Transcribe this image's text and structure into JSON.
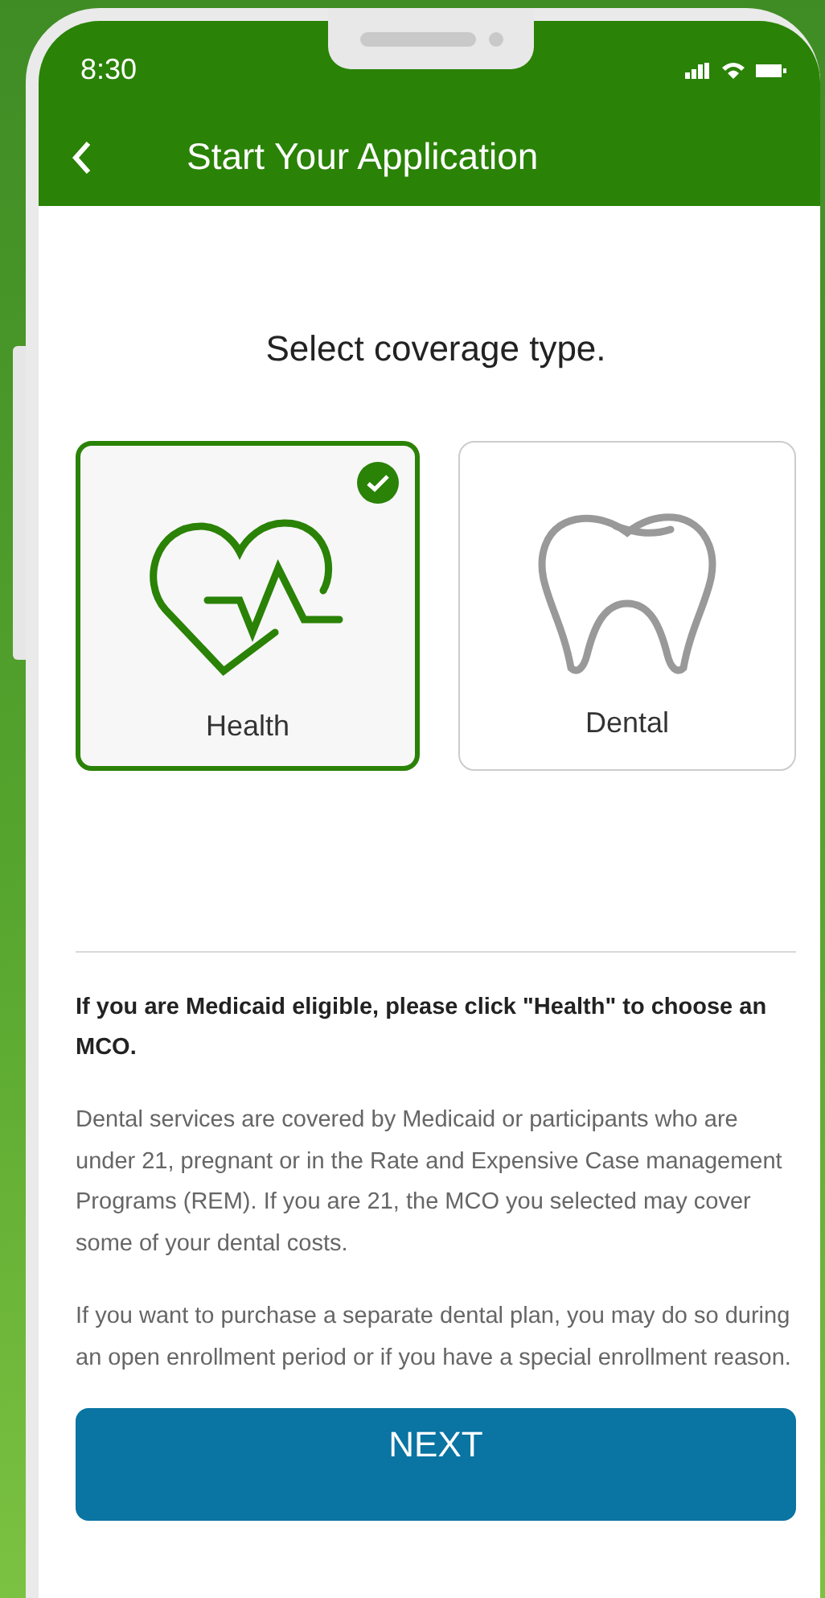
{
  "status_bar": {
    "time": "8:30"
  },
  "header": {
    "title": "Start Your Application"
  },
  "heading": "Select coverage type.",
  "options": [
    {
      "label": "Health",
      "kind": "health",
      "selected": true
    },
    {
      "label": "Dental",
      "kind": "dental",
      "selected": false
    }
  ],
  "notice": "If you are Medicaid eligible, please click \"Health\" to choose an MCO.",
  "paragraphs": [
    "Dental services are covered by Medicaid or participants who are under 21, pregnant or in the Rate and Expensive Case management Programs (REM). If you are 21, the MCO you selected may cover some of your dental costs.",
    "If you want to purchase a separate dental plan, you may do so during an open enrollment period or if you have a special enrollment reason."
  ],
  "button": "NEXT"
}
